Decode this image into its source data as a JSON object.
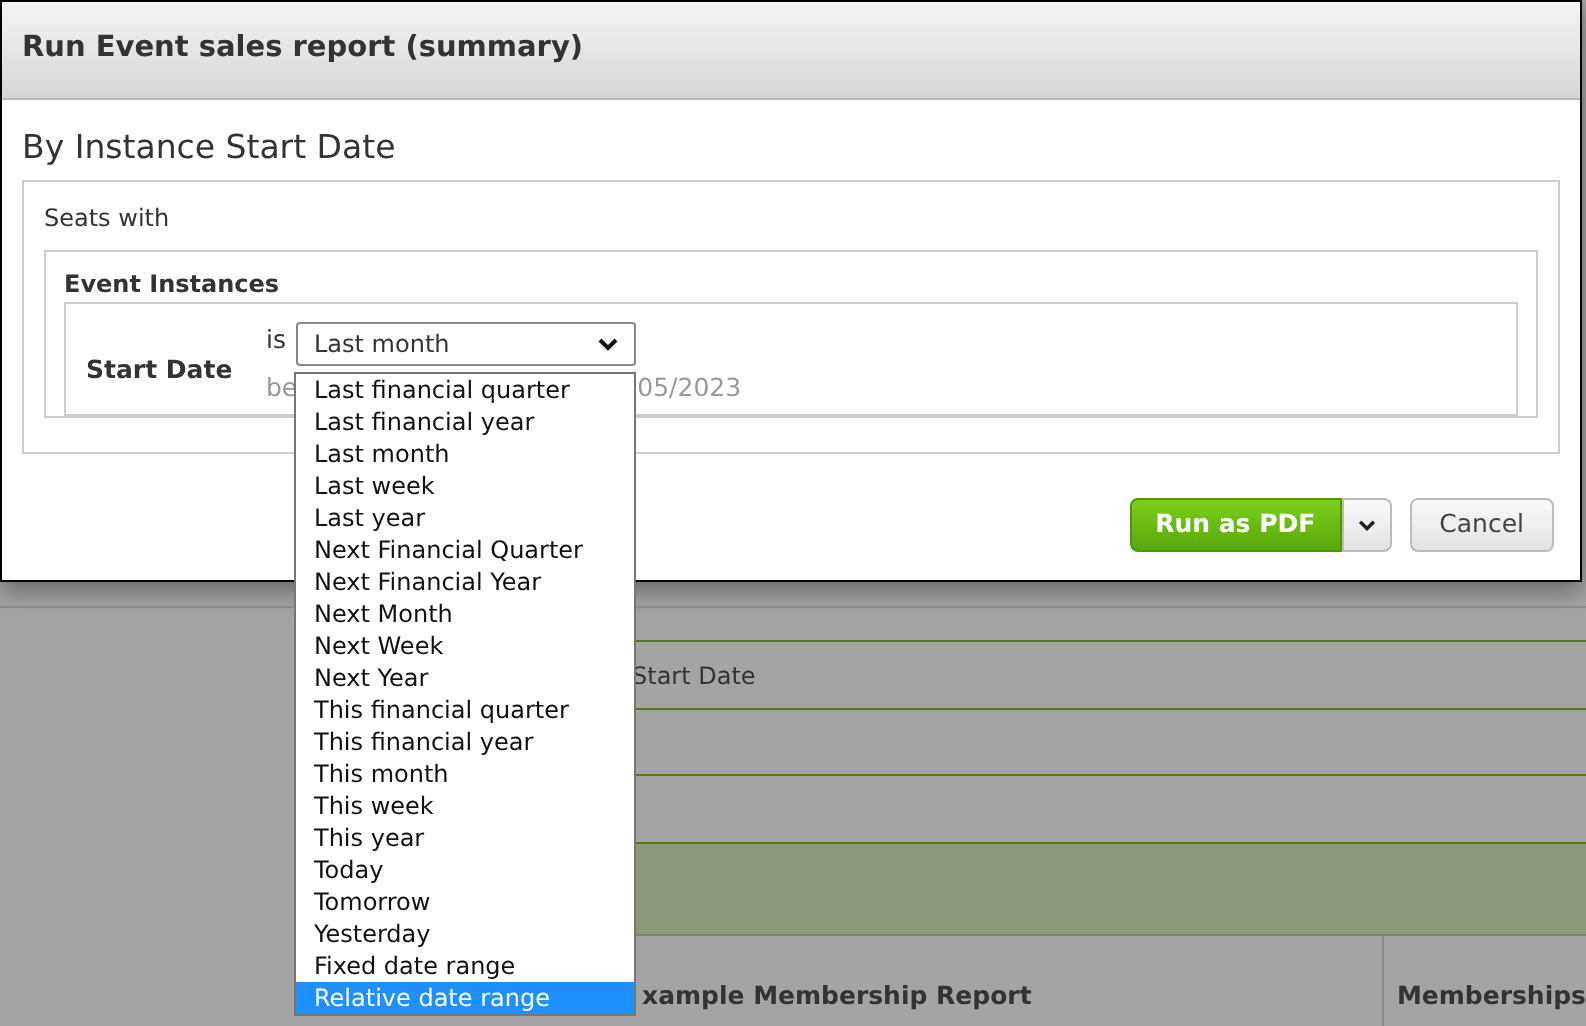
{
  "background": {
    "filter_label": "Start Date",
    "report_name": "xample Membership Report",
    "column_header": "Memberships"
  },
  "dialog": {
    "title": "Run Event sales report (summary)",
    "heading": "By Instance Start Date",
    "group_label": "Seats with",
    "section_label": "Event Instances",
    "field_label": "Start Date",
    "operator": "is",
    "select_value": "Last month",
    "hint_start": "be",
    "hint_end": "05/2023",
    "options": [
      {
        "label": "Last financial quarter",
        "selected": false
      },
      {
        "label": "Last financial year",
        "selected": false
      },
      {
        "label": "Last month",
        "selected": false
      },
      {
        "label": "Last week",
        "selected": false
      },
      {
        "label": "Last year",
        "selected": false
      },
      {
        "label": "Next Financial Quarter",
        "selected": false
      },
      {
        "label": "Next Financial Year",
        "selected": false
      },
      {
        "label": "Next Month",
        "selected": false
      },
      {
        "label": "Next Week",
        "selected": false
      },
      {
        "label": "Next Year",
        "selected": false
      },
      {
        "label": "This financial quarter",
        "selected": false
      },
      {
        "label": "This financial year",
        "selected": false
      },
      {
        "label": "This month",
        "selected": false
      },
      {
        "label": "This week",
        "selected": false
      },
      {
        "label": "This year",
        "selected": false
      },
      {
        "label": "Today",
        "selected": false
      },
      {
        "label": "Tomorrow",
        "selected": false
      },
      {
        "label": "Yesterday",
        "selected": false
      },
      {
        "label": "Fixed date range",
        "selected": false
      },
      {
        "label": "Relative date range",
        "selected": true
      }
    ],
    "buttons": {
      "run": "Run as PDF",
      "cancel": "Cancel"
    }
  }
}
